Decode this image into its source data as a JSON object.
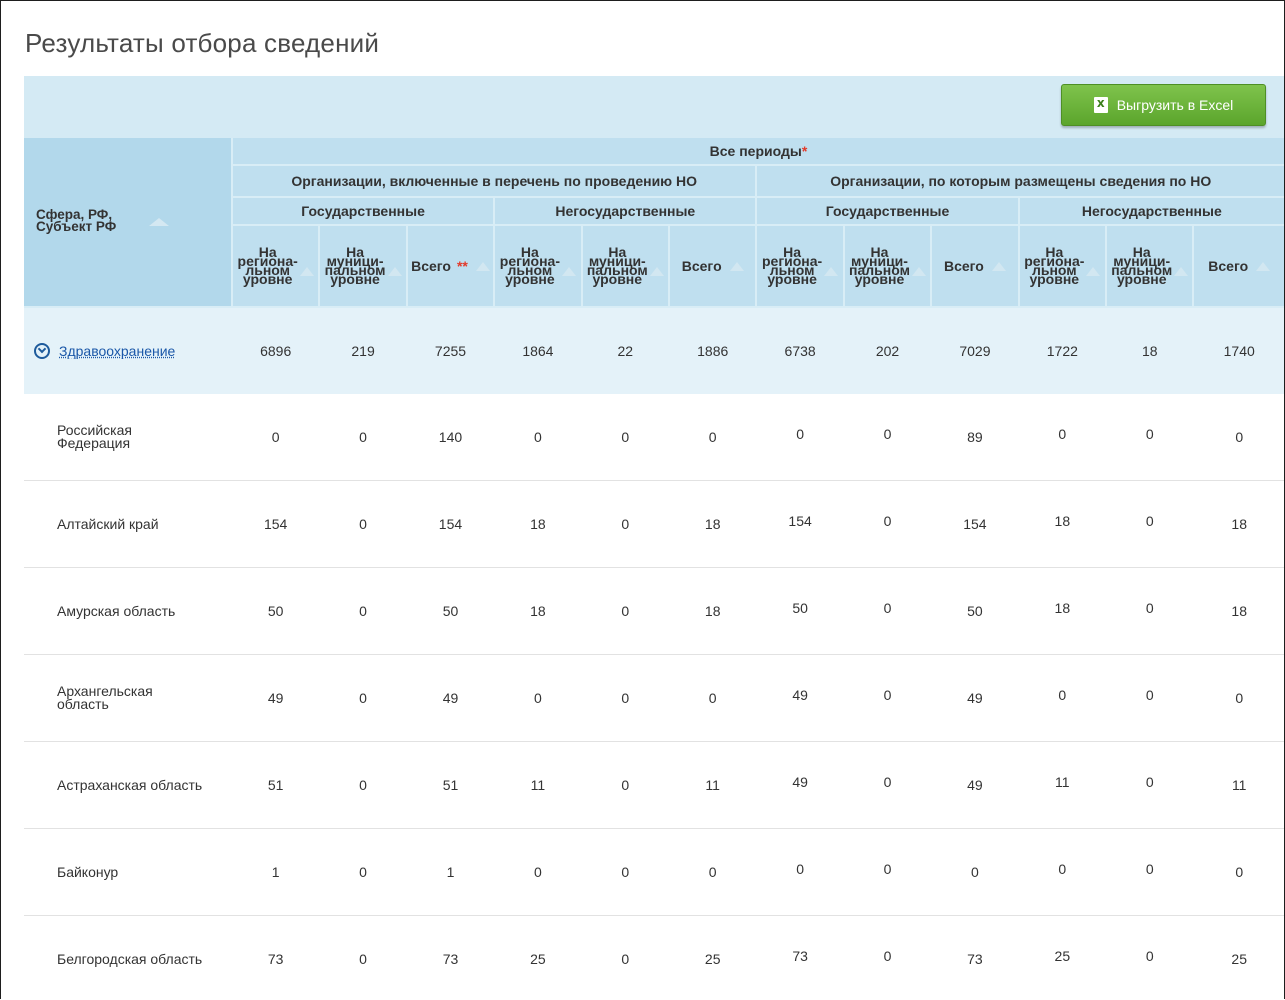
{
  "page": {
    "title": "Результаты отбора сведений"
  },
  "toolbar": {
    "export_label": "Выгрузить в Excel"
  },
  "table": {
    "sfera_header": "Сфера, РФ,\nСубъект РФ",
    "periods_header": "Все периоды",
    "periods_star": "*",
    "group_a": "Организации, включенные в перечень по проведению НО",
    "group_b": "Организации, по которым размещены сведения по НО",
    "gov": "Государственные",
    "nongov": "Негосударственные",
    "sub_regional": "На\nрегиона-\nльном\nуровне",
    "sub_municipal": "На\nмуници-\nпальном\nуровне",
    "sub_total": "Всего",
    "total_star": "**",
    "group_row": {
      "label": "Здравоохранение",
      "values": [
        "6896",
        "219",
        "7255",
        "1864",
        "22",
        "1886",
        "6738",
        "202",
        "7029",
        "1722",
        "18",
        "1740"
      ]
    },
    "rows": [
      {
        "region": "Российская\nФедерация",
        "values": [
          "0",
          "0",
          "140",
          "0",
          "0",
          "0",
          "0",
          "0",
          "89",
          "0",
          "0",
          "0"
        ]
      },
      {
        "region": "Алтайский край",
        "values": [
          "154",
          "0",
          "154",
          "18",
          "0",
          "18",
          "154",
          "0",
          "154",
          "18",
          "0",
          "18"
        ]
      },
      {
        "region": "Амурская область",
        "values": [
          "50",
          "0",
          "50",
          "18",
          "0",
          "18",
          "50",
          "0",
          "50",
          "18",
          "0",
          "18"
        ]
      },
      {
        "region": "Архангельская\nобласть",
        "values": [
          "49",
          "0",
          "49",
          "0",
          "0",
          "0",
          "49",
          "0",
          "49",
          "0",
          "0",
          "0"
        ]
      },
      {
        "region": "Астраханская область",
        "values": [
          "51",
          "0",
          "51",
          "11",
          "0",
          "11",
          "49",
          "0",
          "49",
          "11",
          "0",
          "11"
        ]
      },
      {
        "region": "Байконур",
        "values": [
          "1",
          "0",
          "1",
          "0",
          "0",
          "0",
          "0",
          "0",
          "0",
          "0",
          "0",
          "0"
        ]
      },
      {
        "region": "Белгородская область",
        "values": [
          "73",
          "0",
          "73",
          "25",
          "0",
          "25",
          "73",
          "0",
          "73",
          "25",
          "0",
          "25"
        ]
      }
    ]
  }
}
